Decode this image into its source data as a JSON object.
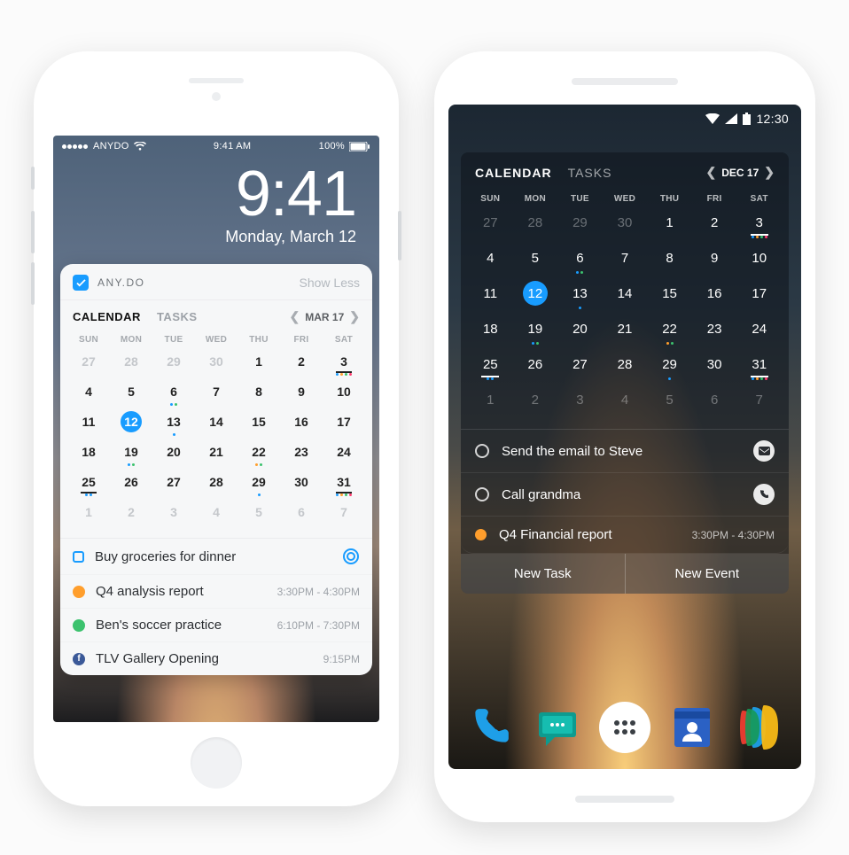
{
  "ios": {
    "status": {
      "carrier": "ANYDO",
      "time": "9:41 AM",
      "battery": "100%"
    },
    "lock": {
      "time": "9:41",
      "date": "Monday, March 12"
    },
    "widget": {
      "app_name": "ANY.DO",
      "show_less": "Show Less",
      "tabs": {
        "calendar": "CALENDAR",
        "tasks": "TASKS"
      },
      "date_label": "MAR 17",
      "dow": [
        "SUN",
        "MON",
        "TUE",
        "WED",
        "THU",
        "FRI",
        "SAT"
      ],
      "weeks": [
        [
          {
            "n": "27",
            "out": true
          },
          {
            "n": "28",
            "out": true
          },
          {
            "n": "29",
            "out": true
          },
          {
            "n": "30",
            "out": true
          },
          {
            "n": "1"
          },
          {
            "n": "2"
          },
          {
            "n": "3",
            "und": true,
            "dots": [
              "db",
              "dor",
              "dg",
              "dpk"
            ]
          }
        ],
        [
          {
            "n": "4"
          },
          {
            "n": "5"
          },
          {
            "n": "6",
            "dots": [
              "db",
              "dg"
            ]
          },
          {
            "n": "7"
          },
          {
            "n": "8"
          },
          {
            "n": "9"
          },
          {
            "n": "10"
          }
        ],
        [
          {
            "n": "11"
          },
          {
            "n": "12",
            "sel": true
          },
          {
            "n": "13",
            "dots": [
              "db"
            ]
          },
          {
            "n": "14"
          },
          {
            "n": "15"
          },
          {
            "n": "16"
          },
          {
            "n": "17"
          }
        ],
        [
          {
            "n": "18"
          },
          {
            "n": "19",
            "dots": [
              "db",
              "dg"
            ]
          },
          {
            "n": "20"
          },
          {
            "n": "21"
          },
          {
            "n": "22",
            "dots": [
              "dor",
              "dg"
            ]
          },
          {
            "n": "23"
          },
          {
            "n": "24"
          }
        ],
        [
          {
            "n": "25",
            "und": true,
            "dots": [
              "db",
              "db"
            ]
          },
          {
            "n": "26"
          },
          {
            "n": "27"
          },
          {
            "n": "28"
          },
          {
            "n": "29",
            "dots": [
              "db"
            ]
          },
          {
            "n": "30"
          },
          {
            "n": "31",
            "und": true,
            "dots": [
              "db",
              "dor",
              "dg",
              "dpk"
            ]
          }
        ],
        [
          {
            "n": "1",
            "out": true
          },
          {
            "n": "2",
            "out": true
          },
          {
            "n": "3",
            "out": true
          },
          {
            "n": "4",
            "out": true
          },
          {
            "n": "5",
            "out": true
          },
          {
            "n": "6",
            "out": true
          },
          {
            "n": "7",
            "out": true
          }
        ]
      ],
      "items": [
        {
          "kind": "task",
          "title": "Buy groceries for dinner"
        },
        {
          "kind": "event",
          "color": "or",
          "title": "Q4 analysis report",
          "time": "3:30PM - 4:30PM"
        },
        {
          "kind": "event",
          "color": "gr",
          "title": "Ben's soccer practice",
          "time": "6:10PM - 7:30PM"
        },
        {
          "kind": "fb",
          "title": "TLV Gallery Opening",
          "time": "9:15PM"
        }
      ]
    }
  },
  "android": {
    "status": {
      "time": "12:30"
    },
    "widget": {
      "tabs": {
        "calendar": "CALENDAR",
        "tasks": "TASKS"
      },
      "date_label": "DEC 17",
      "dow": [
        "SUN",
        "MON",
        "TUE",
        "WED",
        "THU",
        "FRI",
        "SAT"
      ],
      "weeks": [
        [
          {
            "n": "27",
            "out": true
          },
          {
            "n": "28",
            "out": true
          },
          {
            "n": "29",
            "out": true
          },
          {
            "n": "30",
            "out": true
          },
          {
            "n": "1"
          },
          {
            "n": "2"
          },
          {
            "n": "3",
            "und": true,
            "dots": [
              "db",
              "dor",
              "dg",
              "dpk"
            ]
          }
        ],
        [
          {
            "n": "4"
          },
          {
            "n": "5"
          },
          {
            "n": "6",
            "dots": [
              "db",
              "dg"
            ]
          },
          {
            "n": "7"
          },
          {
            "n": "8"
          },
          {
            "n": "9"
          },
          {
            "n": "10"
          }
        ],
        [
          {
            "n": "11"
          },
          {
            "n": "12",
            "sel": true
          },
          {
            "n": "13",
            "dots": [
              "db"
            ]
          },
          {
            "n": "14"
          },
          {
            "n": "15"
          },
          {
            "n": "16"
          },
          {
            "n": "17"
          }
        ],
        [
          {
            "n": "18"
          },
          {
            "n": "19",
            "dots": [
              "db",
              "dg"
            ]
          },
          {
            "n": "20"
          },
          {
            "n": "21"
          },
          {
            "n": "22",
            "dots": [
              "dor",
              "dg"
            ]
          },
          {
            "n": "23"
          },
          {
            "n": "24"
          }
        ],
        [
          {
            "n": "25",
            "und": true,
            "dots": [
              "db",
              "db"
            ]
          },
          {
            "n": "26"
          },
          {
            "n": "27"
          },
          {
            "n": "28"
          },
          {
            "n": "29",
            "dots": [
              "db"
            ]
          },
          {
            "n": "30"
          },
          {
            "n": "31",
            "und": true,
            "dots": [
              "db",
              "dor",
              "dg",
              "dpk"
            ]
          }
        ],
        [
          {
            "n": "1",
            "out": true
          },
          {
            "n": "2",
            "out": true
          },
          {
            "n": "3",
            "out": true
          },
          {
            "n": "4",
            "out": true
          },
          {
            "n": "5",
            "out": true
          },
          {
            "n": "6",
            "out": true
          },
          {
            "n": "7",
            "out": true
          }
        ]
      ],
      "items": [
        {
          "kind": "todo",
          "title": "Send the email to Steve",
          "icon": "mail"
        },
        {
          "kind": "todo",
          "title": "Call grandma",
          "icon": "phone"
        },
        {
          "kind": "event",
          "title": "Q4 Financial report",
          "time": "3:30PM - 4:30PM"
        }
      ],
      "actions": {
        "new_task": "New Task",
        "new_event": "New Event"
      }
    }
  }
}
